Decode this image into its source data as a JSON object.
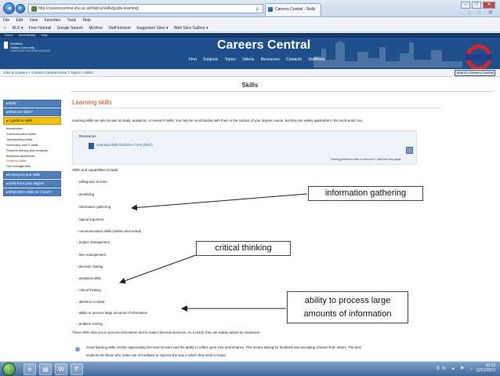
{
  "browser": {
    "address": "http://careerscentral.shu.ac.uk/topics/skills/guide-learning/",
    "address_tools": "ρ - ≣ ¢ ×",
    "tab_title": "Careers Central - Skills",
    "menu": [
      "File",
      "Edit",
      "View",
      "Favorites",
      "Tools",
      "Help"
    ],
    "favorites": [
      "BLS ▾",
      "Free Hotmail",
      "Google Search",
      "MyView",
      "Staff Intranet",
      "Suggested Sites ▾",
      "Web Slice Gallery ▾"
    ],
    "window_buttons": [
      "–",
      "□",
      "✕"
    ],
    "tool_icons": "⌂ ☆ ⚙"
  },
  "site": {
    "top_links": [
      "Home",
      "Accessibility",
      "Help"
    ],
    "logo_line1": "Sheffield",
    "logo_line2": "Hallam University",
    "logo_sub": "CHARTING POSITIVE ROUTES",
    "title": "Careers Central",
    "nav": [
      "Find",
      "Subjects",
      "Topics",
      "Videos",
      "Resources",
      "Contacts",
      "StaffMeta"
    ],
    "breadcrumb": "Jobs & Careers > Careers Central Home > Topics > Skills",
    "search_button": "Search Careers Central",
    "page_heading": "Skills"
  },
  "sidebar": {
    "items_top": [
      "▸Skills",
      "▸What are skills?",
      "▸A guide to skills"
    ],
    "subs": [
      "Introduction",
      "Communication skills",
      "Teamworking skills",
      "Numeracy and IT skills",
      "Problem solving and creativity",
      "Business awareness",
      "Learning skills",
      "Self management"
    ],
    "current_sub": "Learning skills",
    "items_bottom": [
      "▸Employers and skills",
      "▸Skills from your degree",
      "▸What other skills do I have?"
    ]
  },
  "content": {
    "section_title": "Learning skills",
    "intro": "Learning skills are also known as study, academic, or research skills. You may be most familiar with them in the context of your degree course, but they are widely applicable in the work world, too.",
    "resources_label": "Resources",
    "resource_link": "Learning Skills Evidence Form (DOC)",
    "help_note": "Having problems with a resource? Visit the help page.",
    "skills_heading": "Skills and capabilities include:",
    "skills": [
      "- willingness to learn",
      "- prioritising",
      "- information gathering",
      "- logical argument",
      "- communications skills (written and verbal)",
      "- project management",
      "- time management",
      "- decision making",
      "- analytical skills",
      "- critical thinking",
      "- attention to detail",
      "- ability to process large amounts of information",
      "- problem solving"
    ],
    "summary": "These skills help you to process information and to make informed decisions. As a result, they are widely valued by employers.",
    "tip_line1": "Good learning skills involve appreciating the need to learn and the ability to reflect upon your performance. This means asking for feedback and accepting criticism from others. The best",
    "tip_line2": "students are those who make use of feedback to improve the way in which they work in future."
  },
  "annotations": {
    "info": "information gathering",
    "critical": "critical thinking",
    "ability_line1": "ability to process large",
    "ability_line2": "amounts of information"
  },
  "taskbar": {
    "apps": [
      "e",
      "▤",
      "W",
      "P"
    ],
    "tray_icons": "EN ◂ ⚑ ♪",
    "time": "10:33",
    "date": "11/01/2013"
  }
}
